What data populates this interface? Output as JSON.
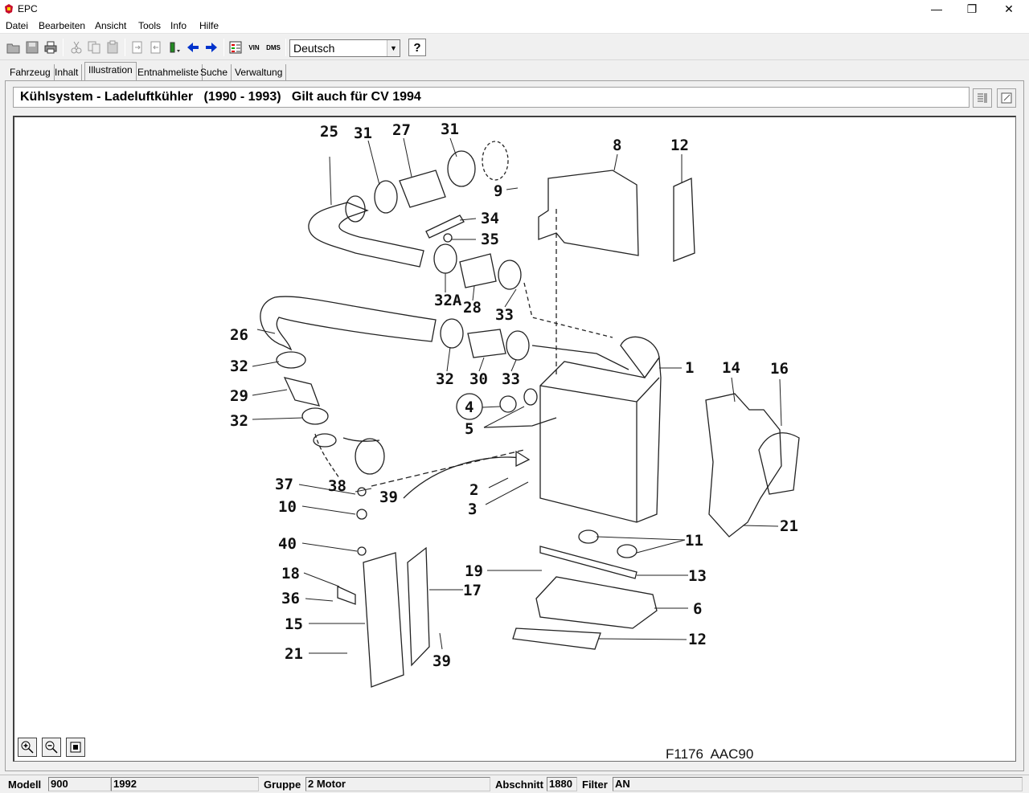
{
  "window": {
    "title": "EPC",
    "minimize_glyph": "—",
    "maximize_glyph": "❐",
    "close_glyph": "✕"
  },
  "menu": [
    "Datei",
    "Bearbeiten",
    "Ansicht",
    "Tools",
    "Info",
    "Hilfe"
  ],
  "toolbar": {
    "language": "Deutsch",
    "vin_label": "VIN",
    "dms_label": "DMS",
    "help_label": "?"
  },
  "tabs": [
    "Fahrzeug",
    "Inhalt",
    "Illustration",
    "Entnahmeliste",
    "Suche",
    "Verwaltung"
  ],
  "active_tab": "Illustration",
  "header": {
    "title": "Kühlsystem - Ladeluftkühler   (1990 - 1993)   Gilt auch für CV 1994"
  },
  "illustration": {
    "figure_code": "F1176  AAC90",
    "callouts": [
      "25",
      "31",
      "27",
      "31",
      "8",
      "12",
      "9",
      "34",
      "35",
      "32A",
      "28",
      "33",
      "26",
      "32",
      "30",
      "33",
      "1",
      "14",
      "16",
      "32",
      "29",
      "4",
      "5",
      "32",
      "37",
      "38",
      "39",
      "2",
      "3",
      "10",
      "21",
      "11",
      "40",
      "19",
      "13",
      "18",
      "36",
      "17",
      "6",
      "15",
      "12",
      "21",
      "39"
    ]
  },
  "status": {
    "modell_label": "Modell",
    "modell_value": "900",
    "year_value": "1992",
    "gruppe_label": "Gruppe",
    "gruppe_value": "2 Motor",
    "abschnitt_label": "Abschnitt",
    "abschnitt_value": "1880",
    "filter_label": "Filter",
    "filter_value": "AN"
  }
}
